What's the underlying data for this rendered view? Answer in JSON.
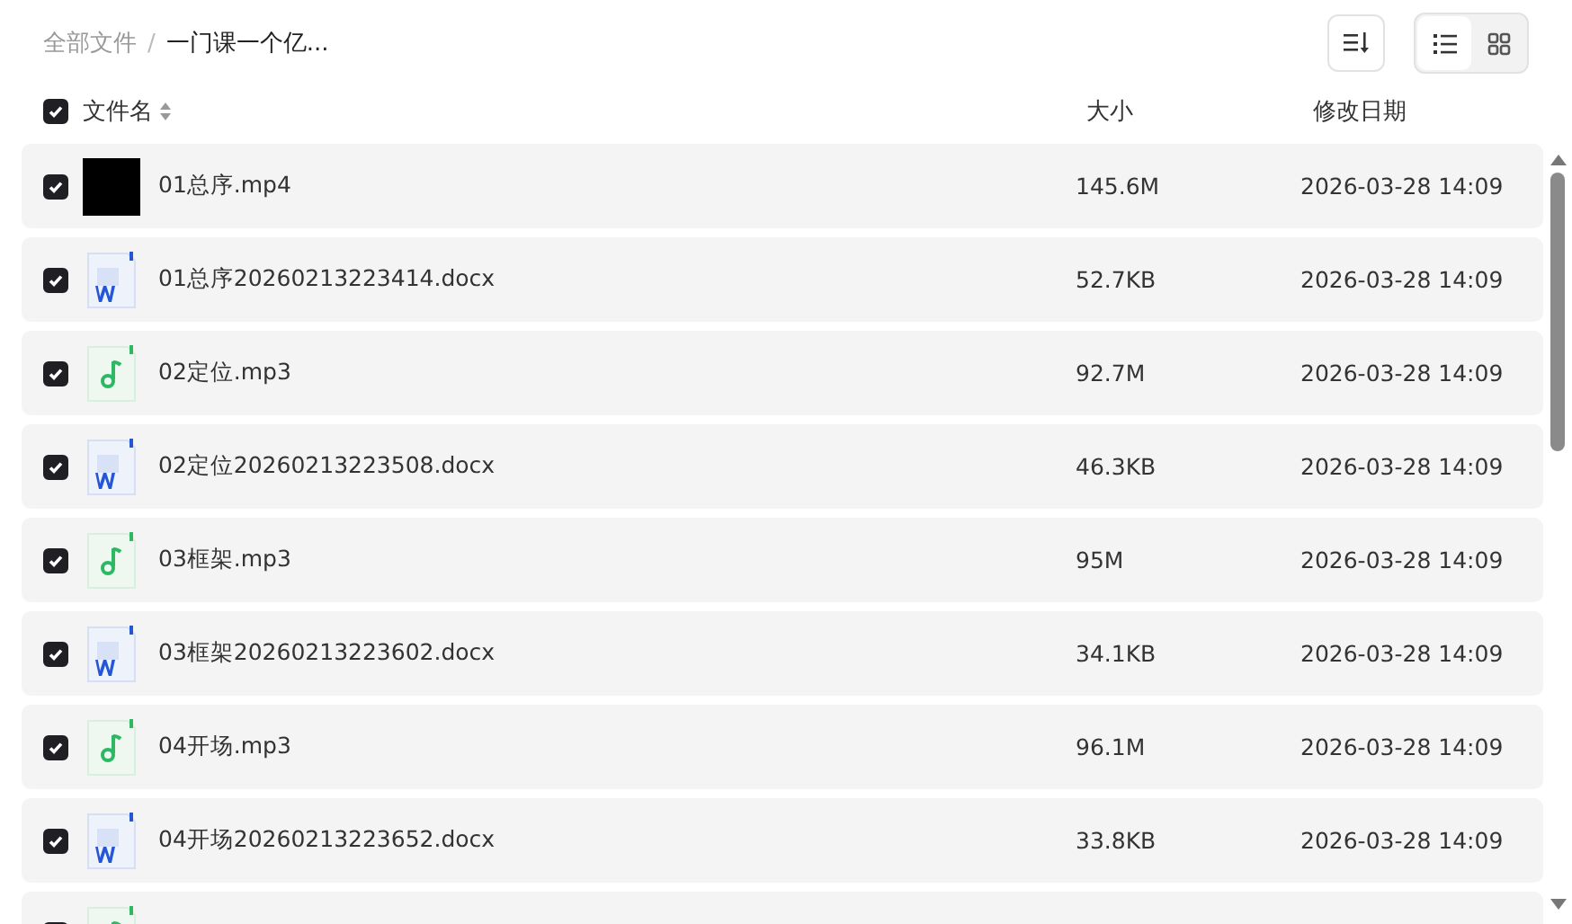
{
  "breadcrumb": {
    "root": "全部文件",
    "separator": "/",
    "current": "一门课一个亿..."
  },
  "toolbar": {
    "view_modes": [
      {
        "kind": "list",
        "selected": true
      },
      {
        "kind": "grid",
        "selected": false
      }
    ]
  },
  "table": {
    "select_all": {
      "checked": true
    },
    "columns": [
      {
        "label": "文件名",
        "sortable": true
      },
      {
        "label": "大小",
        "sortable": false
      },
      {
        "label": "修改日期",
        "sortable": false
      }
    ],
    "rows": [
      {
        "kind": "video",
        "checked": true,
        "name": "01总序.mp4",
        "size": "145.6M",
        "modified": "2026-03-28 14:09"
      },
      {
        "kind": "word",
        "checked": true,
        "name": "01总序20260213223414.docx",
        "size": "52.7KB",
        "modified": "2026-03-28 14:09"
      },
      {
        "kind": "audio",
        "checked": true,
        "name": "02定位.mp3",
        "size": "92.7M",
        "modified": "2026-03-28 14:09"
      },
      {
        "kind": "word",
        "checked": true,
        "name": "02定位20260213223508.docx",
        "size": "46.3KB",
        "modified": "2026-03-28 14:09"
      },
      {
        "kind": "audio",
        "checked": true,
        "name": "03框架.mp3",
        "size": "95M",
        "modified": "2026-03-28 14:09"
      },
      {
        "kind": "word",
        "checked": true,
        "name": "03框架20260213223602.docx",
        "size": "34.1KB",
        "modified": "2026-03-28 14:09"
      },
      {
        "kind": "audio",
        "checked": true,
        "name": "04开场.mp3",
        "size": "96.1M",
        "modified": "2026-03-28 14:09"
      },
      {
        "kind": "word",
        "checked": true,
        "name": "04开场20260213223652.docx",
        "size": "33.8KB",
        "modified": "2026-03-28 14:09"
      },
      {
        "kind": "audio",
        "checked": true
      }
    ]
  }
}
